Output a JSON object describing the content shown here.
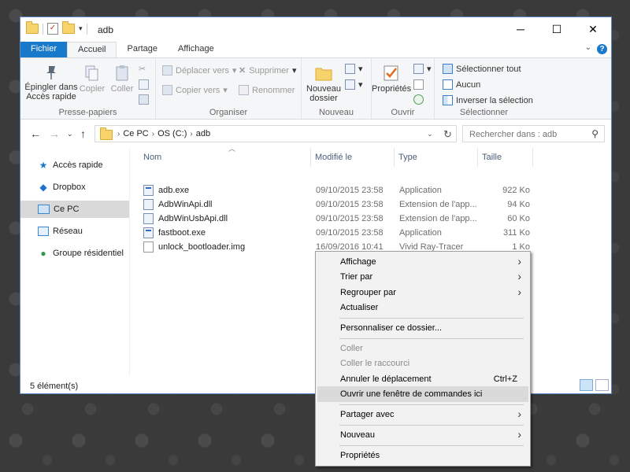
{
  "window": {
    "title": "adb",
    "controls": {
      "minimize": "─",
      "maximize": "☐",
      "close": "✕"
    }
  },
  "ribbon_tabs": [
    "Fichier",
    "Accueil",
    "Partage",
    "Affichage"
  ],
  "ribbon": {
    "presse_papiers": {
      "label": "Presse-papiers",
      "pin": "Épingler dans\nAccès rapide",
      "pin_l1": "Épingler dans",
      "pin_l2": "Accès rapide",
      "copy": "Copier",
      "paste": "Coller"
    },
    "organiser": {
      "label": "Organiser",
      "move_to": "Déplacer vers",
      "copy_to": "Copier vers",
      "delete": "Supprimer",
      "rename": "Renommer"
    },
    "nouveau": {
      "label": "Nouveau",
      "new_folder_l1": "Nouveau",
      "new_folder_l2": "dossier"
    },
    "ouvrir": {
      "label": "Ouvrir",
      "properties": "Propriétés"
    },
    "selectionner": {
      "label": "Sélectionner",
      "select_all": "Sélectionner tout",
      "select_none": "Aucun",
      "invert": "Inverser la sélection"
    }
  },
  "address": {
    "segments": [
      "Ce PC",
      "OS (C:)",
      "adb"
    ],
    "search_placeholder": "Rechercher dans : adb"
  },
  "nav_pane": [
    "Accès rapide",
    "Dropbox",
    "Ce PC",
    "Réseau",
    "Groupe résidentiel"
  ],
  "columns": [
    "Nom",
    "Modifié le",
    "Type",
    "Taille"
  ],
  "files": [
    {
      "name": "adb.exe",
      "modified": "09/10/2015 23:58",
      "type": "Application",
      "size": "922 Ko"
    },
    {
      "name": "AdbWinApi.dll",
      "modified": "09/10/2015 23:58",
      "type": "Extension de l'app...",
      "size": "94 Ko"
    },
    {
      "name": "AdbWinUsbApi.dll",
      "modified": "09/10/2015 23:58",
      "type": "Extension de l'app...",
      "size": "60 Ko"
    },
    {
      "name": "fastboot.exe",
      "modified": "09/10/2015 23:58",
      "type": "Application",
      "size": "311 Ko"
    },
    {
      "name": "unlock_bootloader.img",
      "modified": "16/09/2016 10:41",
      "type": "Vivid Ray-Tracer",
      "size": "1 Ko"
    }
  ],
  "status": {
    "count": "5 élément(s)"
  },
  "context_menu": {
    "items": [
      {
        "label": "Affichage"
      },
      {
        "label": "Trier par"
      },
      {
        "label": "Regrouper par"
      },
      {
        "label": "Actualiser"
      },
      {
        "label": "Personnaliser ce dossier..."
      },
      {
        "label": "Coller"
      },
      {
        "label": "Coller le raccourci"
      },
      {
        "label": "Annuler le déplacement",
        "shortcut": "Ctrl+Z"
      },
      {
        "label": "Ouvrir une fenêtre de commandes ici"
      },
      {
        "label": "Partager avec"
      },
      {
        "label": "Nouveau"
      },
      {
        "label": "Propriétés"
      }
    ]
  }
}
